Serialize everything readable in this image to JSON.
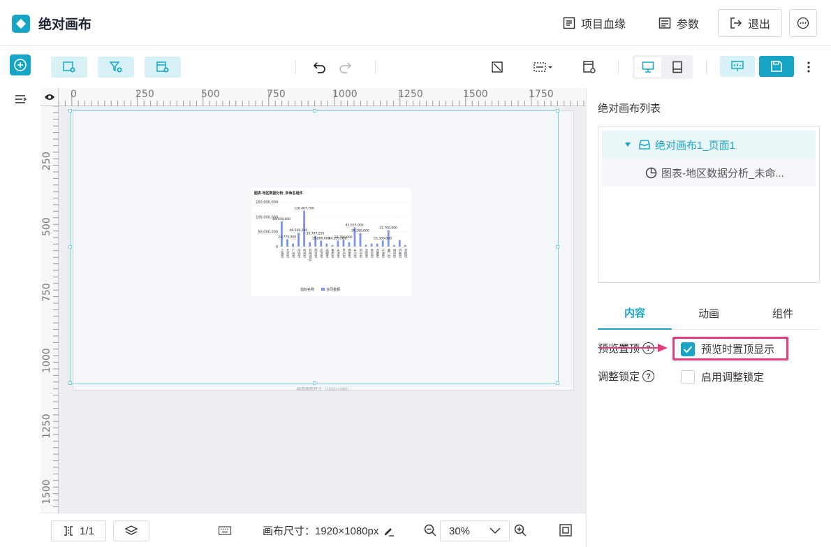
{
  "header": {
    "title": "绝对画布",
    "lineage_label": "项目血缘",
    "params_label": "参数",
    "exit_label": "退出"
  },
  "toolbar": {
    "zoom_hint": "30%"
  },
  "ruler": {
    "h_marks": [
      "0",
      "250",
      "500",
      "750",
      "1000",
      "1250",
      "1500",
      "1750"
    ],
    "v_marks": [
      "250",
      "500",
      "750",
      "1000",
      "1250",
      "1500"
    ]
  },
  "canvas": {
    "size_caption": "画布画布尺寸（1920×1080）"
  },
  "chart_data": {
    "type": "bar",
    "title": "图表-地区数据分析_未命名组件",
    "ylim": [
      0,
      150000000
    ],
    "yticks": [
      "150,000,000",
      "100,000,000",
      "50,000,000",
      "0"
    ],
    "categories": [
      "上海市",
      "北京市",
      "广州市",
      "深圳市",
      "杭州市",
      "其他地区",
      "南京市",
      "武汉市",
      "成都市",
      "重庆市",
      "天津市",
      "苏州市",
      "西安市",
      "长沙市",
      "郑州市",
      "沈阳市",
      "青岛市",
      "合肥市",
      "宁波市",
      "厦门市",
      "福州市",
      "济南市",
      "其他市"
    ],
    "series": [
      {
        "name": "合同金额",
        "values": [
          84508000,
          24775000,
          10000000,
          46549240,
          120467700,
          15000000,
          35797250,
          19800000,
          10000000,
          5000000,
          20000000,
          23750000,
          15000000,
          64555000,
          45555000,
          6000000,
          10000000,
          10000000,
          20280000,
          55300000,
          5000000,
          21700000,
          5000000
        ]
      }
    ],
    "data_labels": [
      "84,508,000",
      "24,775,000",
      "46,549,240",
      "120,467,700",
      "35,797,250",
      "19,800,000",
      "64,555,000",
      "23,750,000",
      "45,555,000",
      "20,280,000",
      "55,300,000",
      "21,700,000"
    ],
    "legend_title": "指标名称",
    "legend": "top-bottom"
  },
  "bottombar": {
    "page_label": "1/1",
    "canvas_size": "画布尺寸：1920×1080px",
    "zoom": "30%"
  },
  "rightpanel": {
    "list_title": "绝对画布列表",
    "tree_root": "绝对画布1_页面1",
    "tree_child": "图表-地区数据分析_未命...",
    "tabs": [
      "内容",
      "动画",
      "组件"
    ],
    "pin_label": "预览置顶",
    "pin_checkbox": "预览时置顶显示",
    "lock_label": "调整锁定",
    "lock_checkbox": "启用调整锁定"
  },
  "colors": {
    "accent": "#17a5c7",
    "highlight": "#e23d7e",
    "bar": "#7b96ea"
  }
}
